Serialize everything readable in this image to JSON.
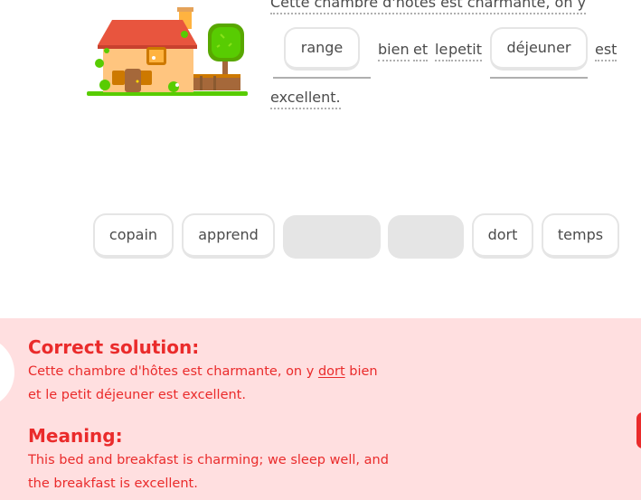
{
  "exercise": {
    "sentence": {
      "line1_text": "Cette chambre d'hôtes est charmante, on y",
      "word_bien": "bien",
      "word_et": "et",
      "word_le": "le",
      "word_petit": "petit",
      "word_est": "est",
      "word_excellent": "excellent."
    },
    "placed_tokens": {
      "first": "range",
      "second": "déjeuner"
    },
    "word_bank": [
      {
        "label": "copain",
        "state": "available"
      },
      {
        "label": "apprend",
        "state": "available"
      },
      {
        "label": "",
        "state": "used"
      },
      {
        "label": "",
        "state": "used"
      },
      {
        "label": "dort",
        "state": "available"
      },
      {
        "label": "temps",
        "state": "available"
      }
    ]
  },
  "feedback": {
    "status": "incorrect",
    "correct_heading": "Correct solution:",
    "solution_before": "Cette chambre d'hôtes est charmante, on y ",
    "solution_highlight": "dort",
    "solution_after": " bien et le petit déjeuner est excellent.",
    "meaning_heading": "Meaning:",
    "meaning_text": "This bed and breakfast is charming; we sleep well, and the breakfast is excellent.",
    "colors": {
      "panel_bg": "#ffdfe0",
      "text": "#ea2b2b"
    }
  },
  "icons": {
    "illustration": "guesthouse-illustration"
  }
}
